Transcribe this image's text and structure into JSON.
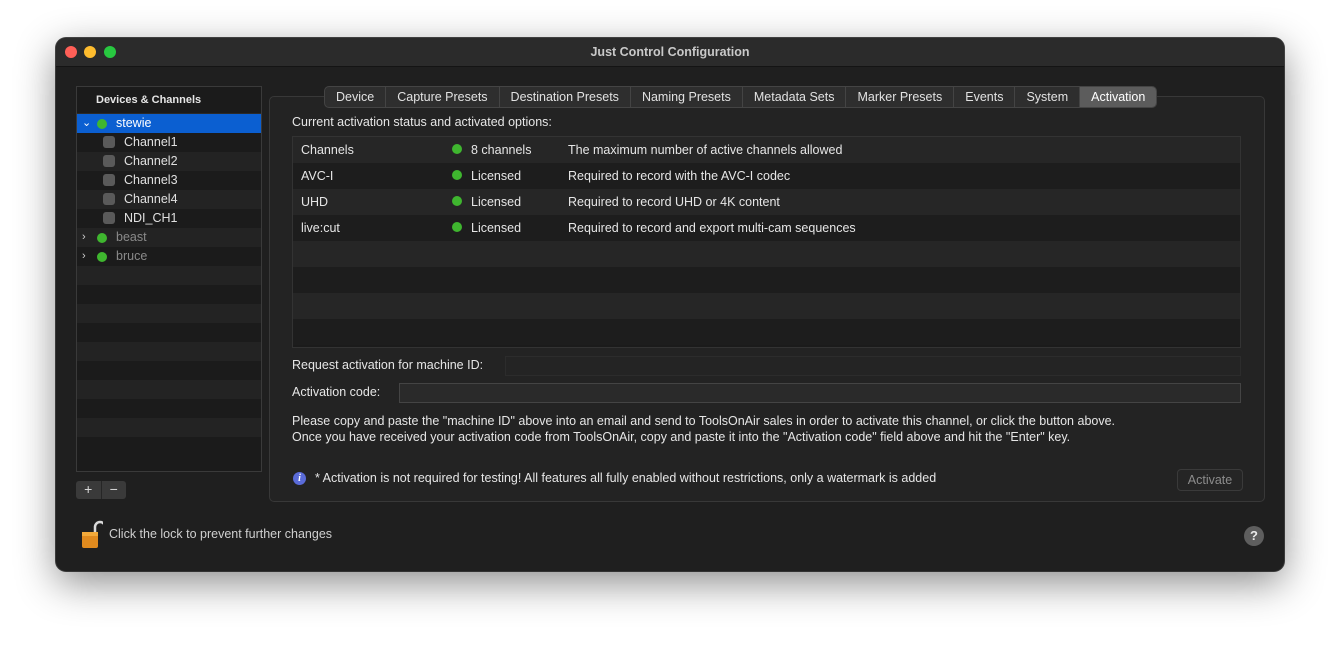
{
  "window": {
    "title": "Just Control Configuration"
  },
  "sidebar": {
    "header": "Devices & Channels",
    "devices": [
      {
        "name": "stewie",
        "expanded": true,
        "selected": true,
        "channels": [
          "Channel1",
          "Channel2",
          "Channel3",
          "Channel4",
          "NDI_CH1"
        ]
      },
      {
        "name": "beast",
        "expanded": false
      },
      {
        "name": "bruce",
        "expanded": false
      }
    ],
    "add_label": "+",
    "remove_label": "−"
  },
  "tabs": [
    "Device",
    "Capture Presets",
    "Destination Presets",
    "Naming Presets",
    "Metadata Sets",
    "Marker Presets",
    "Events",
    "System",
    "Activation"
  ],
  "active_tab": "Activation",
  "activation": {
    "status_title": "Current activation status and activated options:",
    "rows": [
      {
        "name": "Channels",
        "status": "8 channels",
        "description": "The maximum number of active channels allowed"
      },
      {
        "name": "AVC-I",
        "status": "Licensed",
        "description": "Required to record with the AVC-I codec"
      },
      {
        "name": "UHD",
        "status": "Licensed",
        "description": "Required to record UHD or 4K content"
      },
      {
        "name": "live:cut",
        "status": "Licensed",
        "description": "Required to record and export multi-cam sequences"
      }
    ],
    "machine_id_label": "Request activation for machine ID:",
    "machine_id_value": "",
    "code_label": "Activation code:",
    "code_value": "",
    "help_line1": "Please copy and paste the \"machine ID\" above into an email and send to ToolsOnAir sales in order to activate this channel, or click the button above.",
    "help_line2": "Once you have received your activation code from ToolsOnAir, copy and paste it into the \"Activation code\" field above and hit the \"Enter\" key.",
    "info_text": "* Activation is not required for testing! All features all fully enabled without restrictions, only a watermark is added",
    "activate_label": "Activate"
  },
  "footer": {
    "lock_text": "Click the lock to prevent further changes",
    "help_label": "?"
  },
  "colors": {
    "status_green": "#3fb62f",
    "selection_blue": "#0b5fd1"
  }
}
